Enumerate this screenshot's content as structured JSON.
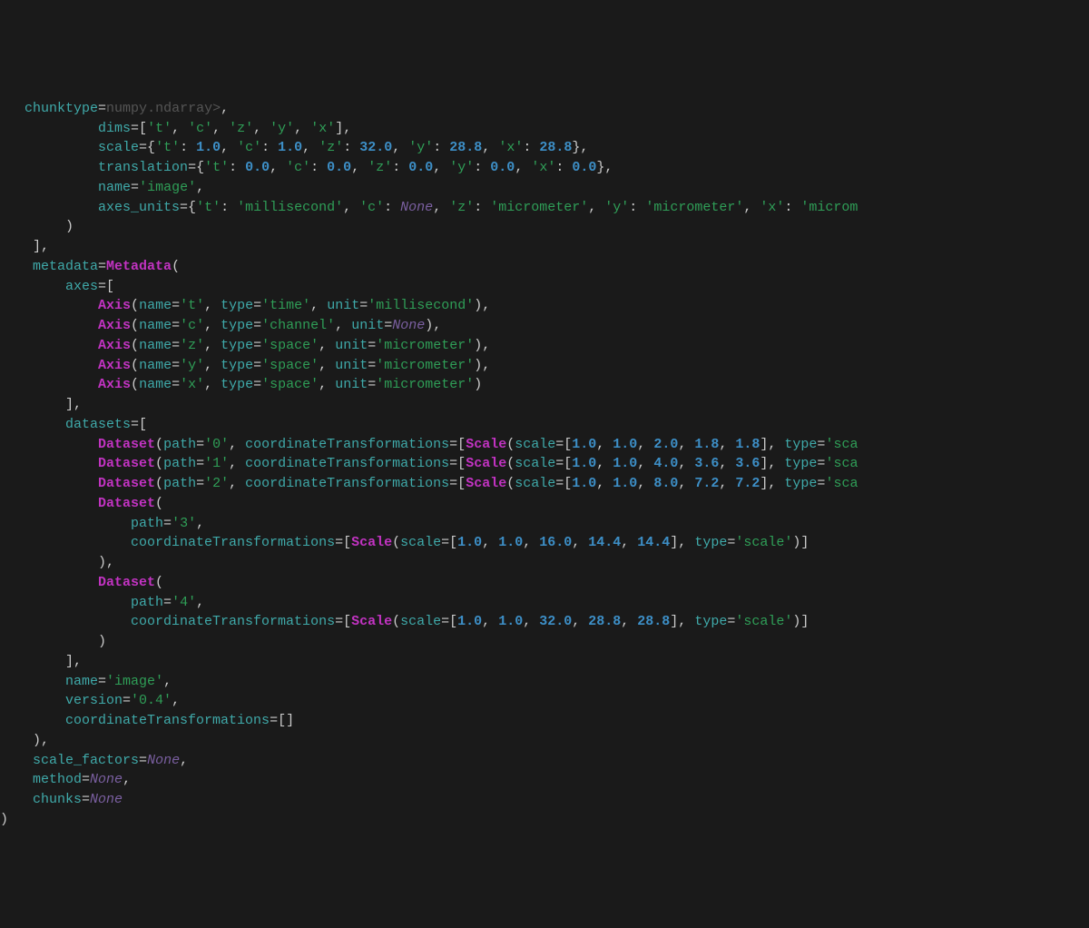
{
  "tokens": [
    {
      "indent": 3,
      "parts": [
        {
          "t": "chunktype",
          "c": "kw"
        },
        {
          "t": "="
        },
        {
          "t": "numpy",
          "c": "dim"
        },
        {
          "t": ".ndarray>",
          "c": "dim"
        },
        {
          "t": ","
        }
      ]
    },
    {
      "indent": 12,
      "parts": [
        {
          "t": "dims",
          "c": "kw"
        },
        {
          "t": "=["
        },
        {
          "t": "'t'",
          "c": "str"
        },
        {
          "t": ", "
        },
        {
          "t": "'c'",
          "c": "str"
        },
        {
          "t": ", "
        },
        {
          "t": "'z'",
          "c": "str"
        },
        {
          "t": ", "
        },
        {
          "t": "'y'",
          "c": "str"
        },
        {
          "t": ", "
        },
        {
          "t": "'x'",
          "c": "str"
        },
        {
          "t": "],"
        }
      ]
    },
    {
      "indent": 12,
      "parts": [
        {
          "t": "scale",
          "c": "kw"
        },
        {
          "t": "={"
        },
        {
          "t": "'t'",
          "c": "str"
        },
        {
          "t": ": "
        },
        {
          "t": "1.0",
          "c": "num"
        },
        {
          "t": ", "
        },
        {
          "t": "'c'",
          "c": "str"
        },
        {
          "t": ": "
        },
        {
          "t": "1.0",
          "c": "num"
        },
        {
          "t": ", "
        },
        {
          "t": "'z'",
          "c": "str"
        },
        {
          "t": ": "
        },
        {
          "t": "32.0",
          "c": "num"
        },
        {
          "t": ", "
        },
        {
          "t": "'y'",
          "c": "str"
        },
        {
          "t": ": "
        },
        {
          "t": "28.8",
          "c": "num"
        },
        {
          "t": ", "
        },
        {
          "t": "'x'",
          "c": "str"
        },
        {
          "t": ": "
        },
        {
          "t": "28.8",
          "c": "num"
        },
        {
          "t": "},"
        }
      ]
    },
    {
      "indent": 12,
      "parts": [
        {
          "t": "translation",
          "c": "kw"
        },
        {
          "t": "={"
        },
        {
          "t": "'t'",
          "c": "str"
        },
        {
          "t": ": "
        },
        {
          "t": "0.0",
          "c": "num"
        },
        {
          "t": ", "
        },
        {
          "t": "'c'",
          "c": "str"
        },
        {
          "t": ": "
        },
        {
          "t": "0.0",
          "c": "num"
        },
        {
          "t": ", "
        },
        {
          "t": "'z'",
          "c": "str"
        },
        {
          "t": ": "
        },
        {
          "t": "0.0",
          "c": "num"
        },
        {
          "t": ", "
        },
        {
          "t": "'y'",
          "c": "str"
        },
        {
          "t": ": "
        },
        {
          "t": "0.0",
          "c": "num"
        },
        {
          "t": ", "
        },
        {
          "t": "'x'",
          "c": "str"
        },
        {
          "t": ": "
        },
        {
          "t": "0.0",
          "c": "num"
        },
        {
          "t": "},"
        }
      ]
    },
    {
      "indent": 12,
      "parts": [
        {
          "t": "name",
          "c": "kw"
        },
        {
          "t": "="
        },
        {
          "t": "'image'",
          "c": "str"
        },
        {
          "t": ","
        }
      ]
    },
    {
      "indent": 12,
      "parts": [
        {
          "t": "axes_units",
          "c": "kw"
        },
        {
          "t": "={"
        },
        {
          "t": "'t'",
          "c": "str"
        },
        {
          "t": ": "
        },
        {
          "t": "'millisecond'",
          "c": "str"
        },
        {
          "t": ", "
        },
        {
          "t": "'c'",
          "c": "str"
        },
        {
          "t": ": "
        },
        {
          "t": "None",
          "c": "none"
        },
        {
          "t": ", "
        },
        {
          "t": "'z'",
          "c": "str"
        },
        {
          "t": ": "
        },
        {
          "t": "'micrometer'",
          "c": "str"
        },
        {
          "t": ", "
        },
        {
          "t": "'y'",
          "c": "str"
        },
        {
          "t": ": "
        },
        {
          "t": "'micrometer'",
          "c": "str"
        },
        {
          "t": ", "
        },
        {
          "t": "'x'",
          "c": "str"
        },
        {
          "t": ": "
        },
        {
          "t": "'microm",
          "c": "str"
        }
      ]
    },
    {
      "indent": 8,
      "parts": [
        {
          "t": ")"
        }
      ]
    },
    {
      "indent": 4,
      "parts": [
        {
          "t": "],"
        }
      ]
    },
    {
      "indent": 4,
      "parts": [
        {
          "t": "metadata",
          "c": "kw"
        },
        {
          "t": "="
        },
        {
          "t": "Metadata",
          "c": "cls"
        },
        {
          "t": "("
        }
      ]
    },
    {
      "indent": 8,
      "parts": [
        {
          "t": "axes",
          "c": "kw"
        },
        {
          "t": "=["
        }
      ]
    },
    {
      "indent": 12,
      "parts": [
        {
          "t": "Axis",
          "c": "cls"
        },
        {
          "t": "("
        },
        {
          "t": "name",
          "c": "kw"
        },
        {
          "t": "="
        },
        {
          "t": "'t'",
          "c": "str"
        },
        {
          "t": ", "
        },
        {
          "t": "type",
          "c": "kw"
        },
        {
          "t": "="
        },
        {
          "t": "'time'",
          "c": "str"
        },
        {
          "t": ", "
        },
        {
          "t": "unit",
          "c": "kw"
        },
        {
          "t": "="
        },
        {
          "t": "'millisecond'",
          "c": "str"
        },
        {
          "t": "),"
        }
      ]
    },
    {
      "indent": 12,
      "parts": [
        {
          "t": "Axis",
          "c": "cls"
        },
        {
          "t": "("
        },
        {
          "t": "name",
          "c": "kw"
        },
        {
          "t": "="
        },
        {
          "t": "'c'",
          "c": "str"
        },
        {
          "t": ", "
        },
        {
          "t": "type",
          "c": "kw"
        },
        {
          "t": "="
        },
        {
          "t": "'channel'",
          "c": "str"
        },
        {
          "t": ", "
        },
        {
          "t": "unit",
          "c": "kw"
        },
        {
          "t": "="
        },
        {
          "t": "None",
          "c": "none"
        },
        {
          "t": "),"
        }
      ]
    },
    {
      "indent": 12,
      "parts": [
        {
          "t": "Axis",
          "c": "cls"
        },
        {
          "t": "("
        },
        {
          "t": "name",
          "c": "kw"
        },
        {
          "t": "="
        },
        {
          "t": "'z'",
          "c": "str"
        },
        {
          "t": ", "
        },
        {
          "t": "type",
          "c": "kw"
        },
        {
          "t": "="
        },
        {
          "t": "'space'",
          "c": "str"
        },
        {
          "t": ", "
        },
        {
          "t": "unit",
          "c": "kw"
        },
        {
          "t": "="
        },
        {
          "t": "'micrometer'",
          "c": "str"
        },
        {
          "t": "),"
        }
      ]
    },
    {
      "indent": 12,
      "parts": [
        {
          "t": "Axis",
          "c": "cls"
        },
        {
          "t": "("
        },
        {
          "t": "name",
          "c": "kw"
        },
        {
          "t": "="
        },
        {
          "t": "'y'",
          "c": "str"
        },
        {
          "t": ", "
        },
        {
          "t": "type",
          "c": "kw"
        },
        {
          "t": "="
        },
        {
          "t": "'space'",
          "c": "str"
        },
        {
          "t": ", "
        },
        {
          "t": "unit",
          "c": "kw"
        },
        {
          "t": "="
        },
        {
          "t": "'micrometer'",
          "c": "str"
        },
        {
          "t": "),"
        }
      ]
    },
    {
      "indent": 12,
      "parts": [
        {
          "t": "Axis",
          "c": "cls"
        },
        {
          "t": "("
        },
        {
          "t": "name",
          "c": "kw"
        },
        {
          "t": "="
        },
        {
          "t": "'x'",
          "c": "str"
        },
        {
          "t": ", "
        },
        {
          "t": "type",
          "c": "kw"
        },
        {
          "t": "="
        },
        {
          "t": "'space'",
          "c": "str"
        },
        {
          "t": ", "
        },
        {
          "t": "unit",
          "c": "kw"
        },
        {
          "t": "="
        },
        {
          "t": "'micrometer'",
          "c": "str"
        },
        {
          "t": ")"
        }
      ]
    },
    {
      "indent": 8,
      "parts": [
        {
          "t": "],"
        }
      ]
    },
    {
      "indent": 8,
      "parts": [
        {
          "t": "datasets",
          "c": "kw"
        },
        {
          "t": "=["
        }
      ]
    },
    {
      "indent": 12,
      "parts": [
        {
          "t": "Dataset",
          "c": "cls"
        },
        {
          "t": "("
        },
        {
          "t": "path",
          "c": "kw"
        },
        {
          "t": "="
        },
        {
          "t": "'0'",
          "c": "str"
        },
        {
          "t": ", "
        },
        {
          "t": "coordinateTransformations",
          "c": "kw"
        },
        {
          "t": "=["
        },
        {
          "t": "Scale",
          "c": "cls"
        },
        {
          "t": "("
        },
        {
          "t": "scale",
          "c": "kw"
        },
        {
          "t": "=["
        },
        {
          "t": "1.0",
          "c": "num"
        },
        {
          "t": ", "
        },
        {
          "t": "1.0",
          "c": "num"
        },
        {
          "t": ", "
        },
        {
          "t": "2.0",
          "c": "num"
        },
        {
          "t": ", "
        },
        {
          "t": "1.8",
          "c": "num"
        },
        {
          "t": ", "
        },
        {
          "t": "1.8",
          "c": "num"
        },
        {
          "t": "], "
        },
        {
          "t": "type",
          "c": "kw"
        },
        {
          "t": "="
        },
        {
          "t": "'sca",
          "c": "str"
        }
      ]
    },
    {
      "indent": 12,
      "parts": [
        {
          "t": "Dataset",
          "c": "cls"
        },
        {
          "t": "("
        },
        {
          "t": "path",
          "c": "kw"
        },
        {
          "t": "="
        },
        {
          "t": "'1'",
          "c": "str"
        },
        {
          "t": ", "
        },
        {
          "t": "coordinateTransformations",
          "c": "kw"
        },
        {
          "t": "=["
        },
        {
          "t": "Scale",
          "c": "cls"
        },
        {
          "t": "("
        },
        {
          "t": "scale",
          "c": "kw"
        },
        {
          "t": "=["
        },
        {
          "t": "1.0",
          "c": "num"
        },
        {
          "t": ", "
        },
        {
          "t": "1.0",
          "c": "num"
        },
        {
          "t": ", "
        },
        {
          "t": "4.0",
          "c": "num"
        },
        {
          "t": ", "
        },
        {
          "t": "3.6",
          "c": "num"
        },
        {
          "t": ", "
        },
        {
          "t": "3.6",
          "c": "num"
        },
        {
          "t": "], "
        },
        {
          "t": "type",
          "c": "kw"
        },
        {
          "t": "="
        },
        {
          "t": "'sca",
          "c": "str"
        }
      ]
    },
    {
      "indent": 12,
      "parts": [
        {
          "t": "Dataset",
          "c": "cls"
        },
        {
          "t": "("
        },
        {
          "t": "path",
          "c": "kw"
        },
        {
          "t": "="
        },
        {
          "t": "'2'",
          "c": "str"
        },
        {
          "t": ", "
        },
        {
          "t": "coordinateTransformations",
          "c": "kw"
        },
        {
          "t": "=["
        },
        {
          "t": "Scale",
          "c": "cls"
        },
        {
          "t": "("
        },
        {
          "t": "scale",
          "c": "kw"
        },
        {
          "t": "=["
        },
        {
          "t": "1.0",
          "c": "num"
        },
        {
          "t": ", "
        },
        {
          "t": "1.0",
          "c": "num"
        },
        {
          "t": ", "
        },
        {
          "t": "8.0",
          "c": "num"
        },
        {
          "t": ", "
        },
        {
          "t": "7.2",
          "c": "num"
        },
        {
          "t": ", "
        },
        {
          "t": "7.2",
          "c": "num"
        },
        {
          "t": "], "
        },
        {
          "t": "type",
          "c": "kw"
        },
        {
          "t": "="
        },
        {
          "t": "'sca",
          "c": "str"
        }
      ]
    },
    {
      "indent": 12,
      "parts": [
        {
          "t": "Dataset",
          "c": "cls"
        },
        {
          "t": "("
        }
      ]
    },
    {
      "indent": 16,
      "parts": [
        {
          "t": "path",
          "c": "kw"
        },
        {
          "t": "="
        },
        {
          "t": "'3'",
          "c": "str"
        },
        {
          "t": ","
        }
      ]
    },
    {
      "indent": 16,
      "parts": [
        {
          "t": "coordinateTransformations",
          "c": "kw"
        },
        {
          "t": "=["
        },
        {
          "t": "Scale",
          "c": "cls"
        },
        {
          "t": "("
        },
        {
          "t": "scale",
          "c": "kw"
        },
        {
          "t": "=["
        },
        {
          "t": "1.0",
          "c": "num"
        },
        {
          "t": ", "
        },
        {
          "t": "1.0",
          "c": "num"
        },
        {
          "t": ", "
        },
        {
          "t": "16.0",
          "c": "num"
        },
        {
          "t": ", "
        },
        {
          "t": "14.4",
          "c": "num"
        },
        {
          "t": ", "
        },
        {
          "t": "14.4",
          "c": "num"
        },
        {
          "t": "], "
        },
        {
          "t": "type",
          "c": "kw"
        },
        {
          "t": "="
        },
        {
          "t": "'scale'",
          "c": "str"
        },
        {
          "t": ")]"
        }
      ]
    },
    {
      "indent": 12,
      "parts": [
        {
          "t": "),"
        }
      ]
    },
    {
      "indent": 12,
      "parts": [
        {
          "t": "Dataset",
          "c": "cls"
        },
        {
          "t": "("
        }
      ]
    },
    {
      "indent": 16,
      "parts": [
        {
          "t": "path",
          "c": "kw"
        },
        {
          "t": "="
        },
        {
          "t": "'4'",
          "c": "str"
        },
        {
          "t": ","
        }
      ]
    },
    {
      "indent": 16,
      "parts": [
        {
          "t": "coordinateTransformations",
          "c": "kw"
        },
        {
          "t": "=["
        },
        {
          "t": "Scale",
          "c": "cls"
        },
        {
          "t": "("
        },
        {
          "t": "scale",
          "c": "kw"
        },
        {
          "t": "=["
        },
        {
          "t": "1.0",
          "c": "num"
        },
        {
          "t": ", "
        },
        {
          "t": "1.0",
          "c": "num"
        },
        {
          "t": ", "
        },
        {
          "t": "32.0",
          "c": "num"
        },
        {
          "t": ", "
        },
        {
          "t": "28.8",
          "c": "num"
        },
        {
          "t": ", "
        },
        {
          "t": "28.8",
          "c": "num"
        },
        {
          "t": "], "
        },
        {
          "t": "type",
          "c": "kw"
        },
        {
          "t": "="
        },
        {
          "t": "'scale'",
          "c": "str"
        },
        {
          "t": ")]"
        }
      ]
    },
    {
      "indent": 12,
      "parts": [
        {
          "t": ")"
        }
      ]
    },
    {
      "indent": 8,
      "parts": [
        {
          "t": "],"
        }
      ]
    },
    {
      "indent": 8,
      "parts": [
        {
          "t": "name",
          "c": "kw"
        },
        {
          "t": "="
        },
        {
          "t": "'image'",
          "c": "str"
        },
        {
          "t": ","
        }
      ]
    },
    {
      "indent": 8,
      "parts": [
        {
          "t": "version",
          "c": "kw"
        },
        {
          "t": "="
        },
        {
          "t": "'0.4'",
          "c": "str"
        },
        {
          "t": ","
        }
      ]
    },
    {
      "indent": 8,
      "parts": [
        {
          "t": "coordinateTransformations",
          "c": "kw"
        },
        {
          "t": "=[]"
        }
      ]
    },
    {
      "indent": 4,
      "parts": [
        {
          "t": "),"
        }
      ]
    },
    {
      "indent": 4,
      "parts": [
        {
          "t": "scale_factors",
          "c": "kw"
        },
        {
          "t": "="
        },
        {
          "t": "None",
          "c": "none"
        },
        {
          "t": ","
        }
      ]
    },
    {
      "indent": 4,
      "parts": [
        {
          "t": "method",
          "c": "kw"
        },
        {
          "t": "="
        },
        {
          "t": "None",
          "c": "none"
        },
        {
          "t": ","
        }
      ]
    },
    {
      "indent": 4,
      "parts": [
        {
          "t": "chunks",
          "c": "kw"
        },
        {
          "t": "="
        },
        {
          "t": "None",
          "c": "none"
        }
      ]
    },
    {
      "indent": 0,
      "parts": [
        {
          "t": ")"
        }
      ]
    }
  ]
}
